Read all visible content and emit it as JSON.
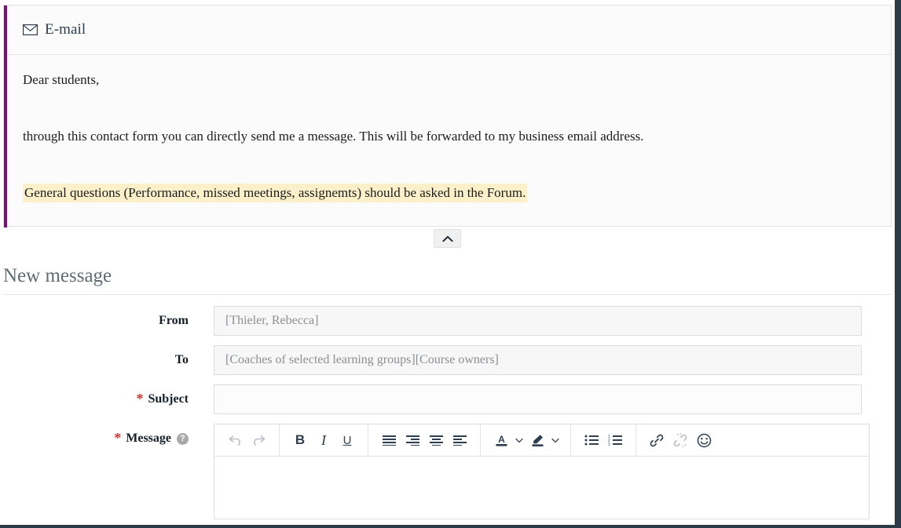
{
  "panel": {
    "icon": "envelope-icon",
    "title": "E-mail",
    "accent_color": "#7b0f7b",
    "paragraphs": [
      "Dear students,",
      "through this contact form you can directly send me a message. This will be forwarded to my business email address."
    ],
    "highlighted_paragraph": "General questions (Performance, missed meetings, assignemts) should be asked in the Forum.",
    "highlight_color": "#fbf0c9",
    "collapse_button": "collapse-chevron-up"
  },
  "section": {
    "title": "New message"
  },
  "form": {
    "required_marker": "*",
    "required_color": "#d5332c",
    "help_glyph": "?",
    "rows": [
      {
        "label": "From",
        "value": "[Thieler, Rebecca]",
        "required": false,
        "disabled": true
      },
      {
        "label": "To",
        "value": "[Coaches of selected learning groups][Course owners]",
        "required": false,
        "disabled": true
      },
      {
        "label": "Subject",
        "value": "",
        "placeholder": "",
        "required": true,
        "disabled": false
      },
      {
        "label": "Message",
        "value": "",
        "required": true,
        "disabled": false
      }
    ]
  },
  "editor": {
    "toolbar_groups": [
      {
        "name": "history",
        "buttons": [
          {
            "name": "undo-icon",
            "label": "Undo",
            "disabled": true
          },
          {
            "name": "redo-icon",
            "label": "Redo",
            "disabled": true
          }
        ]
      },
      {
        "name": "text-style",
        "buttons": [
          {
            "name": "bold-icon",
            "label": "B",
            "disabled": false
          },
          {
            "name": "italic-icon",
            "label": "I",
            "disabled": false
          },
          {
            "name": "underline-icon",
            "label": "U",
            "disabled": false
          }
        ]
      },
      {
        "name": "alignment",
        "buttons": [
          {
            "name": "align-justify-icon",
            "label": "Justify",
            "disabled": false
          },
          {
            "name": "align-right-icon",
            "label": "Align right",
            "disabled": false
          },
          {
            "name": "align-center-icon",
            "label": "Align center",
            "disabled": false
          },
          {
            "name": "align-left-icon",
            "label": "Align left",
            "disabled": false
          }
        ]
      },
      {
        "name": "color",
        "buttons": [
          {
            "name": "text-color-icon",
            "label": "A",
            "disabled": false
          },
          {
            "name": "text-color-chevron-down-icon",
            "label": "",
            "disabled": false
          },
          {
            "name": "highlight-color-icon",
            "label": "Highlight",
            "disabled": false
          },
          {
            "name": "highlight-color-chevron-down-icon",
            "label": "",
            "disabled": false
          }
        ]
      },
      {
        "name": "lists",
        "buttons": [
          {
            "name": "bullet-list-icon",
            "label": "Bullet list",
            "disabled": false
          },
          {
            "name": "numbered-list-icon",
            "label": "Numbered list",
            "disabled": false
          }
        ]
      },
      {
        "name": "insert",
        "buttons": [
          {
            "name": "link-icon",
            "label": "Insert link",
            "disabled": false
          },
          {
            "name": "unlink-icon",
            "label": "Remove link",
            "disabled": true
          },
          {
            "name": "emoji-icon",
            "label": "Emoji",
            "disabled": false
          }
        ]
      }
    ],
    "content": ""
  }
}
